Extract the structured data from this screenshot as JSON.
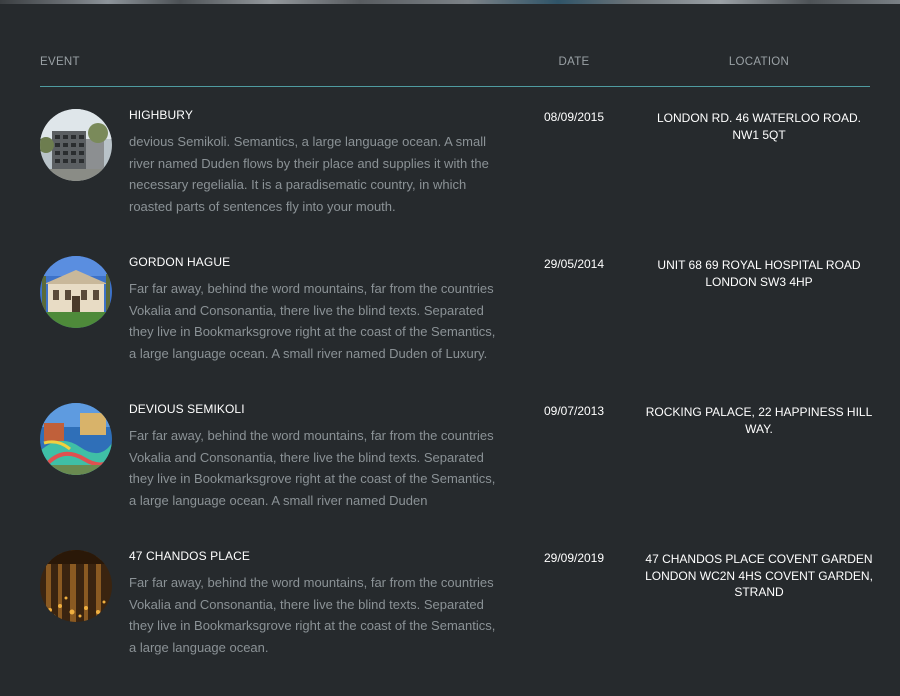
{
  "table": {
    "headers": {
      "event": "EVENT",
      "date": "DATE",
      "location": "LOCATION"
    },
    "rows": [
      {
        "title": "HIGHBURY",
        "description": "devious Semikoli. Semantics, a large language ocean. A small river named Duden flows by their place and supplies it with the necessary regelialia. It is a paradisematic country, in which roasted parts of sentences fly into your mouth.",
        "date": "08/09/2015",
        "location": "LONDON RD. 46 WATERLOO ROAD. NW1 5QT",
        "thumb_icon": "apartment-building-photo"
      },
      {
        "title": "GORDON HAGUE",
        "description": "Far far away, behind the word mountains, far from the countries Vokalia and Consonantia, there live the blind texts. Separated they live in Bookmarksgrove right at the coast of the Semantics, a large language ocean. A small river named Duden of Luxury.",
        "date": "29/05/2014",
        "location": "UNIT 68 69 ROYAL HOSPITAL ROAD LONDON SW3 4HP",
        "thumb_icon": "villa-photo"
      },
      {
        "title": "DEVIOUS SEMIKOLI",
        "description": "Far far away, behind the word mountains, far from the countries Vokalia and Consonantia, there live the blind texts. Separated they live in Bookmarksgrove right at the coast of the Semantics, a large language ocean. A small river named Duden",
        "date": "09/07/2013",
        "location": "ROCKING PALACE, 22 HAPPINESS HILL WAY.",
        "thumb_icon": "water-park-photo"
      },
      {
        "title": "47 CHANDOS PLACE",
        "description": "Far far away, behind the word mountains, far from the countries Vokalia and Consonantia, there live the blind texts. Separated they live in Bookmarksgrove right at the coast of the Semantics, a large language ocean.",
        "date": "29/09/2019",
        "location": "47 CHANDOS PLACE COVENT GARDEN LONDON WC2N 4HS COVENT GARDEN, STRAND",
        "thumb_icon": "candlelit-venue-photo"
      }
    ]
  }
}
